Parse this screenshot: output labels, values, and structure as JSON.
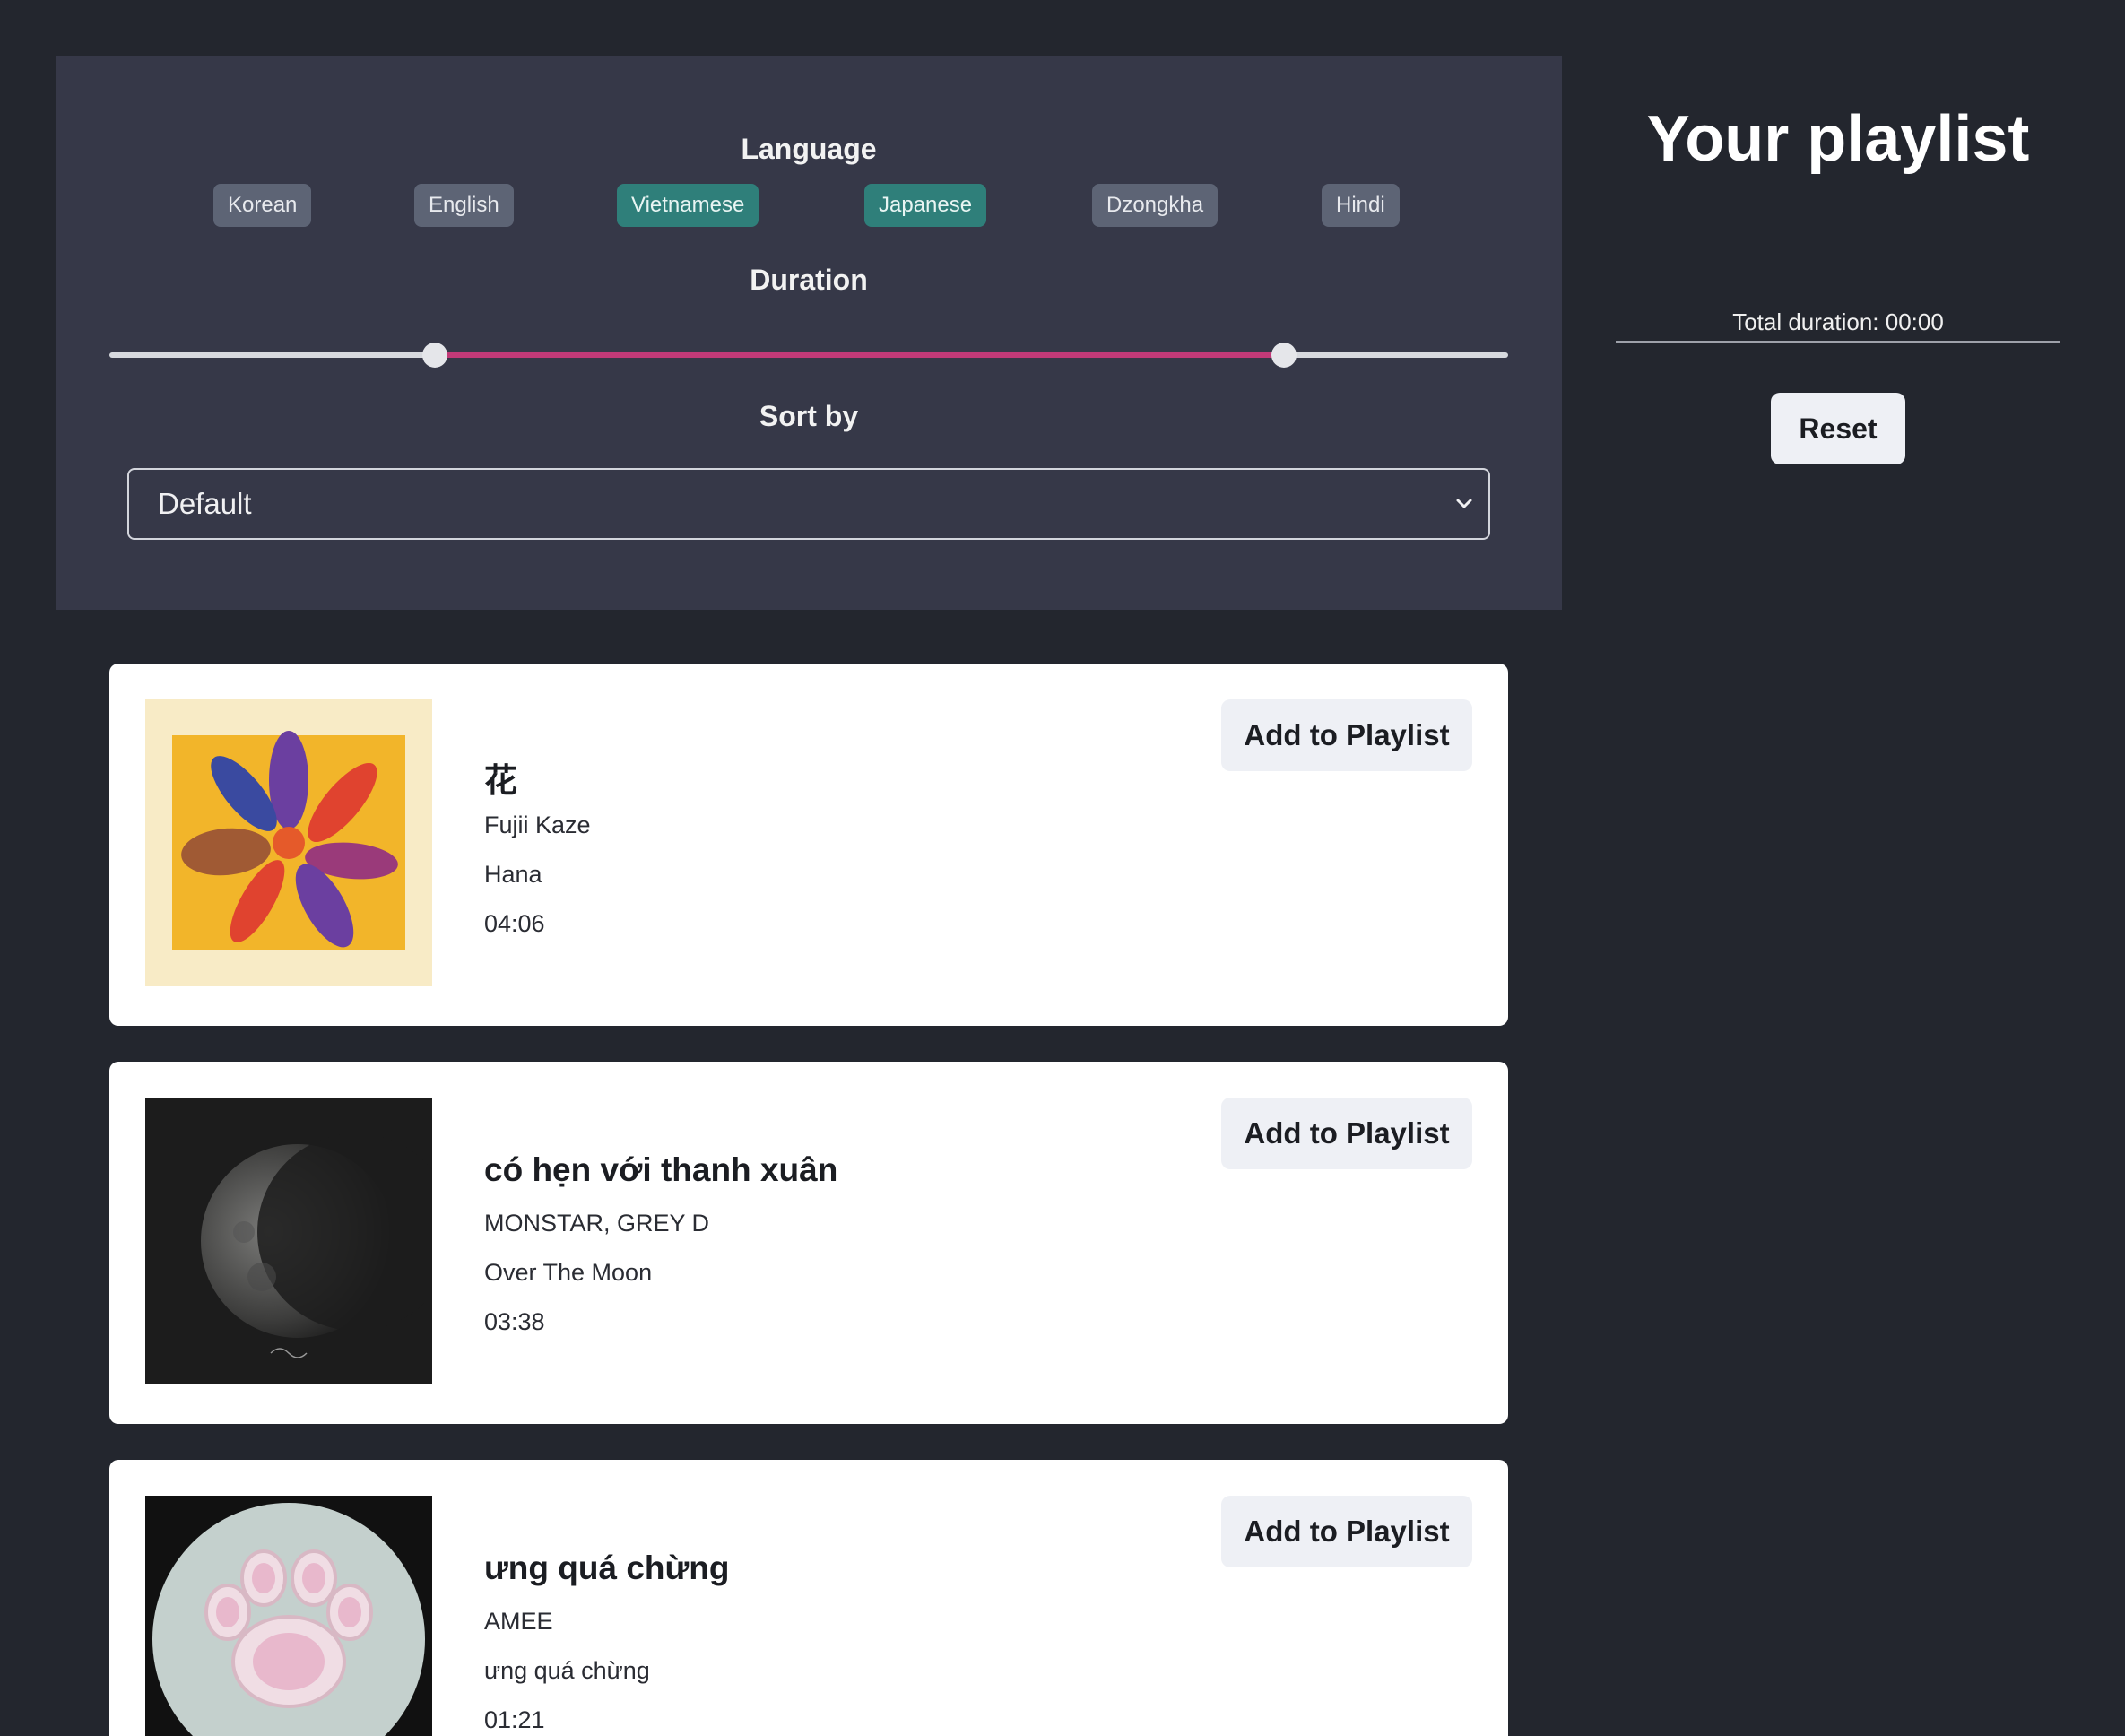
{
  "filters": {
    "language_title": "Language",
    "languages": [
      {
        "label": "Korean",
        "active": false
      },
      {
        "label": "English",
        "active": false
      },
      {
        "label": "Vietnamese",
        "active": true
      },
      {
        "label": "Japanese",
        "active": true
      },
      {
        "label": "Dzongkha",
        "active": false
      },
      {
        "label": "Hindi",
        "active": false
      }
    ],
    "duration_title": "Duration",
    "duration_range": {
      "low": 0.233,
      "high": 0.84
    },
    "sort_title": "Sort by",
    "sort_value": "Default"
  },
  "playlist": {
    "title": "Your playlist",
    "total_duration": "Total duration: 00:00",
    "reset_label": "Reset"
  },
  "songs": [
    {
      "title": "花",
      "artist": "Fujii Kaze",
      "album": "Hana",
      "duration": "04:06",
      "button": "Add to Playlist",
      "cover": "flower-album-art"
    },
    {
      "title": "có hẹn với thanh xuân",
      "artist": "MONSTAR, GREY D",
      "album": "Over The Moon",
      "duration": "03:38",
      "button": "Add to Playlist",
      "cover": "moon-album-art"
    },
    {
      "title": "ưng quá chừng",
      "artist": "AMEE",
      "album": "ưng quá chừng",
      "duration": "01:21",
      "button": "Add to Playlist",
      "cover": "paw-album-art"
    }
  ],
  "colors": {
    "background": "#23262e",
    "panel": "#363848",
    "tag": "#5d6475",
    "tag_active": "#2f7f7a",
    "slider_range": "#c23a78",
    "button_bg": "#eef0f5"
  }
}
